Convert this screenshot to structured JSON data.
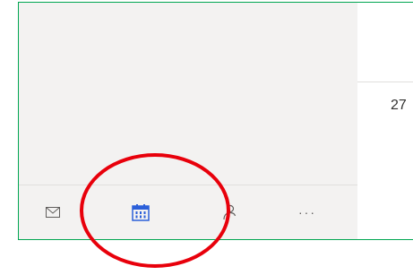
{
  "calendar": {
    "day_number": "27"
  },
  "nav": {
    "items": [
      {
        "id": "mail",
        "icon": "mail-icon"
      },
      {
        "id": "calendar",
        "icon": "calendar-icon",
        "selected": true
      },
      {
        "id": "people",
        "icon": "people-icon"
      },
      {
        "id": "more",
        "icon": "more-icon",
        "label": "···"
      }
    ]
  },
  "colors": {
    "frame_border": "#00a651",
    "nav_background": "#f3f2f1",
    "calendar_accent": "#2b5fd9",
    "icon_gray": "#605e5c",
    "annotation": "#e8000b"
  }
}
